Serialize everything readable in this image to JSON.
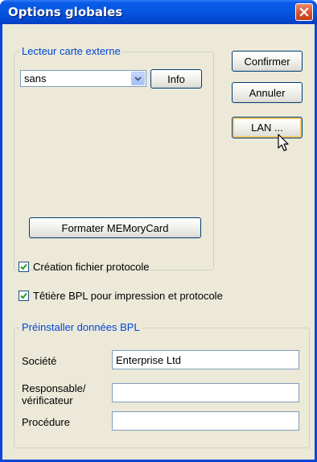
{
  "window": {
    "title": "Options globales"
  },
  "lecteur": {
    "legend": "Lecteur carte externe",
    "select_value": "sans",
    "info_label": "Info",
    "format_label": "Formater MEMoryCard"
  },
  "buttons": {
    "confirm": "Confirmer",
    "cancel": "Annuler",
    "lan": "LAN ..."
  },
  "checks": {
    "protocol_file": {
      "label": "Création fichier protocole",
      "checked": true
    },
    "header_bpl": {
      "label": "Têtière BPL pour impression et protocole",
      "checked": true
    }
  },
  "preinstall": {
    "legend": "Préinstaller données BPL",
    "company_label": "Société",
    "company_value": "Enterprise Ltd",
    "responsible_label_1": "Responsable/",
    "responsible_label_2": "vérificateur",
    "responsible_value": "",
    "procedure_label": "Procédure",
    "procedure_value": ""
  },
  "colors": {
    "titlebar": "#0558e0",
    "dialog_bg": "#ece9d8",
    "legend_text": "#0046d5",
    "close_button": "#d24e2a"
  }
}
